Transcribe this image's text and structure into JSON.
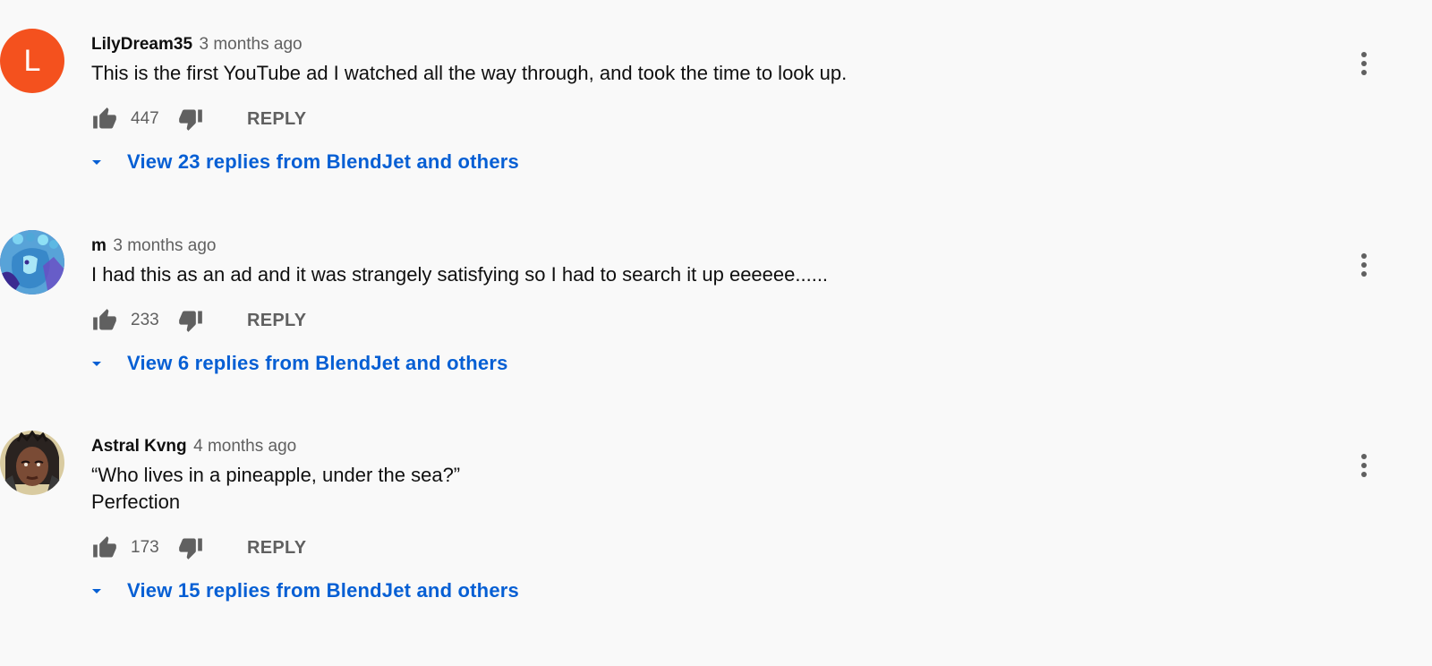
{
  "comments": [
    {
      "author": "LilyDream35",
      "time": "3 months ago",
      "avatar_letter": "L",
      "avatar_color": "#f4511e",
      "text": "This is the first YouTube ad I watched all the way through, and took the time to look up.",
      "likes": "447",
      "reply_label": "REPLY",
      "replies_label": "View 23 replies from BlendJet and others"
    },
    {
      "author": "m",
      "time": "3 months ago",
      "text": "I had this as an ad and it was strangely satisfying so I had to search it up eeeeee......",
      "likes": "233",
      "reply_label": "REPLY",
      "replies_label": "View 6 replies from BlendJet and others"
    },
    {
      "author": "Astral Kvng",
      "time": "4 months ago",
      "text": "“Who lives in a pineapple, under the sea?”\nPerfection",
      "likes": "173",
      "reply_label": "REPLY",
      "replies_label": "View 15 replies from BlendJet and others"
    }
  ],
  "colors": {
    "link": "#065fd4",
    "secondary_text": "#606060",
    "background": "#f9f9f9"
  },
  "icons": [
    "thumb-up-icon",
    "thumb-down-icon",
    "caret-down-icon",
    "more-vert-icon"
  ]
}
